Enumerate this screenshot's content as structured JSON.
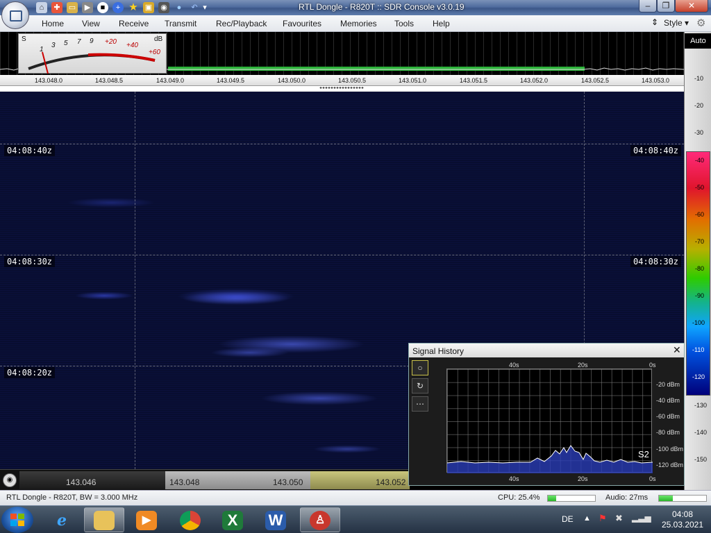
{
  "window": {
    "title": "RTL Dongle - R820T :: SDR Console v3.0.19",
    "controls": [
      "–",
      "❐",
      "✕"
    ]
  },
  "menu": {
    "items": [
      "Home",
      "View",
      "Receive",
      "Transmit",
      "Rec/Playback",
      "Favourites",
      "Memories",
      "Tools",
      "Help"
    ],
    "style_label": "Style"
  },
  "smeter": {
    "s_label": "S",
    "db_label": "dB",
    "scale": [
      "1",
      "3",
      "5",
      "7",
      "9",
      "+20",
      "+40",
      "+60"
    ]
  },
  "frequency_scale": [
    "143.048.0",
    "143.048.5",
    "143.049.0",
    "143.049.5",
    "143.050.0",
    "143.050.5",
    "143.051.0",
    "143.051.5",
    "143.052.0",
    "143.052.5",
    "143.053.0"
  ],
  "waterfall": {
    "time_labels": [
      "04:08:40z",
      "04:08:30z",
      "04:08:20z"
    ]
  },
  "db_scale": {
    "auto_label": "Auto",
    "ticks": [
      "-10",
      "-20",
      "-30",
      "-40",
      "-50",
      "-60",
      "-70",
      "-80",
      "-90",
      "-100",
      "-110",
      "-120",
      "-130",
      "-140",
      "-150"
    ]
  },
  "band_strip": {
    "frequencies": [
      "143.046",
      "143.048",
      "143.050",
      "143.052"
    ]
  },
  "signal_history": {
    "title": "Signal History",
    "close": "✕",
    "x_labels": [
      "40s",
      "20s",
      "0s"
    ],
    "y_labels": [
      "-20 dBm",
      "-40 dBm",
      "-60 dBm",
      "-80 dBm",
      "-100 dBm",
      "-120 dBm"
    ],
    "s_reading": "S2",
    "tool_icons": [
      "○",
      "↻",
      "⋯"
    ]
  },
  "status": {
    "device": "RTL Dongle - R820T, BW = 3.000 MHz",
    "cpu": "CPU: 25.4%",
    "cpu_level": 0.18,
    "audio": "Audio: 27ms",
    "audio_level": 0.3
  },
  "taskbar": {
    "language": "DE",
    "time": "04:08",
    "date": "25.03.2021"
  },
  "colors": {
    "accent": "#4f6c9e",
    "waterfall_bg": "#060a22",
    "signal": "#3c5cff"
  }
}
